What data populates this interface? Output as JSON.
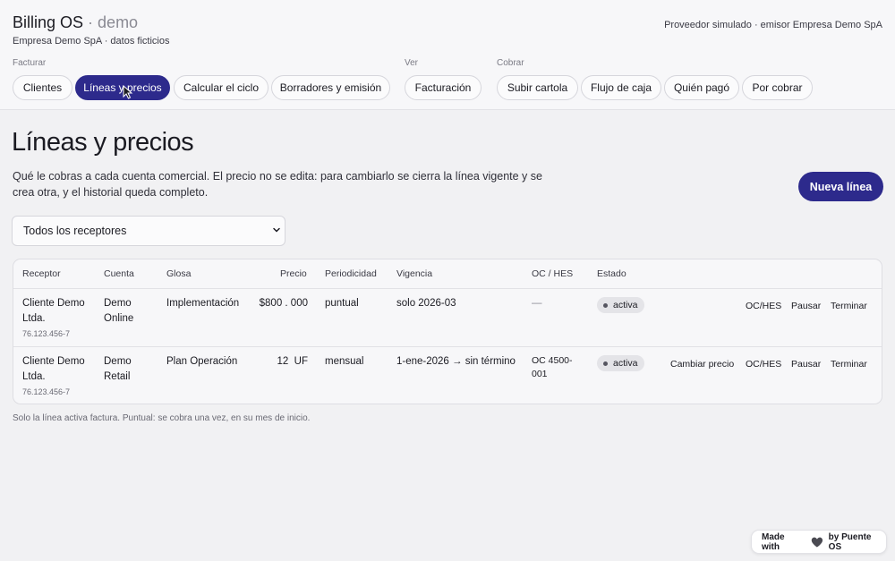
{
  "header": {
    "app_name": "Billing OS",
    "app_suffix": "· demo",
    "org": "Empresa Demo SpA · datos ficticios",
    "provider": "Proveedor simulado · emisor Empresa Demo SpA",
    "groups": [
      "Facturar",
      "Ver",
      "Cobrar"
    ],
    "nav": [
      "Clientes",
      "Líneas y precios",
      "Calcular el ciclo",
      "Borradores y emisión",
      "Facturación",
      "Subir cartola",
      "Flujo de caja",
      "Quién pagó",
      "Por cobrar"
    ],
    "active_nav": "Líneas y precios"
  },
  "main": {
    "title": "Líneas y precios",
    "description": "Qué le cobras a cada cuenta comercial. El precio no se edita: para cambiarlo se cierra la línea vigente y se crea otra, y el historial queda completo.",
    "new_button": "Nueva línea",
    "filter_value": "Todos los receptores",
    "footnote": "Solo la línea activa factura. Puntual: se cobra una vez, en su mes de inicio."
  },
  "table": {
    "columns": [
      "Receptor",
      "Cuenta",
      "Glosa",
      "Precio",
      "Periodicidad",
      "Vigencia",
      "OC / HES",
      "Estado"
    ],
    "rows": [
      {
        "receptor": "Cliente Demo Ltda.",
        "rut": "76.123.456-7",
        "cuenta": "Demo Online",
        "glosa": "Implementación",
        "precio": "$800 . 000",
        "periodicidad": "puntual",
        "vigencia": "solo 2026-03",
        "oc": "—",
        "estado": "activa",
        "actions": [
          "OC/HES",
          "Pausar",
          "Terminar"
        ]
      },
      {
        "receptor": "Cliente Demo Ltda.",
        "rut": "76.123.456-7",
        "cuenta": "Demo Retail",
        "glosa": "Plan Operación",
        "precio": "12  UF",
        "periodicidad": "mensual",
        "vigencia": "1-ene-2026 → sin término",
        "oc": "OC 4500-001",
        "estado": "activa",
        "actions": [
          "Cambiar precio",
          "OC/HES",
          "Pausar",
          "Terminar"
        ]
      }
    ]
  },
  "badge": {
    "made_with": "Made with",
    "by": "by Puente OS",
    "heart_icon": "heart-icon"
  },
  "colors": {
    "accent": "#2d2a8c",
    "background": "#f1f1f3"
  }
}
